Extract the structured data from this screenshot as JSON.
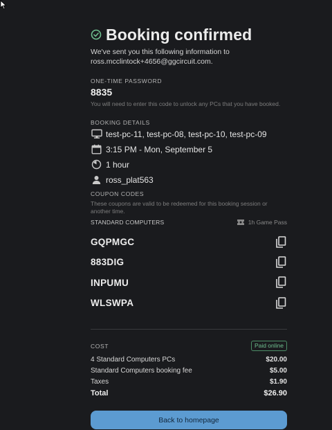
{
  "header": {
    "title": "Booking confirmed",
    "intro_line1": "We've sent you this following information to",
    "intro_line2": "ross.mcclintock+4656@ggcircuit.com."
  },
  "otp": {
    "label": "ONE-TIME PASSWORD",
    "code": "8835",
    "hint": "You will need to enter this code to unlock any PCs that you have booked."
  },
  "booking": {
    "label": "BOOKING DETAILS",
    "pcs": "test-pc-11, test-pc-08, test-pc-10, test-pc-09",
    "datetime": "3:15 PM - Mon, September 5",
    "duration": "1 hour",
    "user": "ross_plat563",
    "icons": [
      "monitor-icon",
      "calendar-icon",
      "clock-icon",
      "user-icon"
    ]
  },
  "coupons": {
    "label": "COUPON CODES",
    "hint": "These coupons are valid to be redeemed for this booking session or another time.",
    "category": "STANDARD COMPUTERS",
    "pass": "1h Game Pass",
    "codes": [
      "GQPMGC",
      "883DIG",
      "INPUMU",
      "WLSWPA"
    ]
  },
  "cost": {
    "label": "COST",
    "badge": "Paid online",
    "items": [
      {
        "label": "4 Standard Computers PCs",
        "amount": "$20.00"
      },
      {
        "label": "Standard Computers booking fee",
        "amount": "$5.00"
      },
      {
        "label": "Taxes",
        "amount": "$1.90"
      }
    ],
    "total_label": "Total",
    "total_amount": "$26.90"
  },
  "actions": {
    "home_button": "Back to homepage"
  },
  "colors": {
    "background": "#1a1b1e",
    "accent": "#5c9bd1",
    "paid": "#6fbf8f"
  }
}
